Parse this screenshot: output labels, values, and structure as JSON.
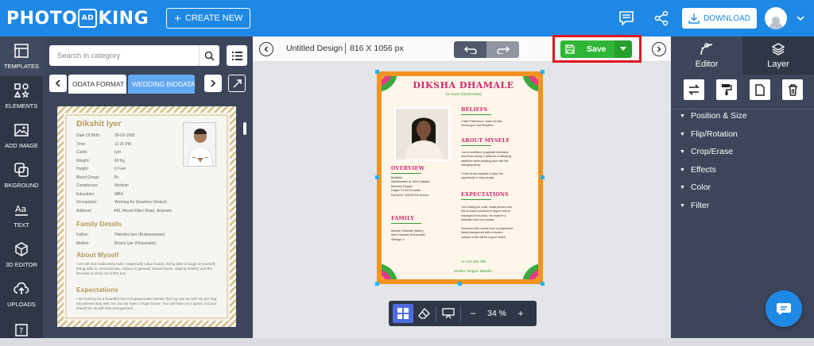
{
  "brand": {
    "logo_left": "PHOTO",
    "logo_mid": "AD",
    "logo_right": "KING"
  },
  "header": {
    "create_label": "CREATE NEW",
    "download_label": "DOWNLOAD"
  },
  "leftnav": {
    "items": [
      {
        "label": "TEMPLATES"
      },
      {
        "label": "ELEMENTS"
      },
      {
        "label": "ADD IMAGE"
      },
      {
        "label": "BKGROUND"
      },
      {
        "label": "TEXT"
      },
      {
        "label": "3D EDITOR"
      },
      {
        "label": "UPLOADS"
      }
    ]
  },
  "panel": {
    "search_placeholder": "Search in category",
    "tabs": [
      "ODATA FORMAT",
      "WEDDING BIODATA"
    ],
    "thumbnail": {
      "name": "Dikshit Iyer",
      "fields": [
        [
          "Date Of Birth:",
          "28-03-1995"
        ],
        [
          "Time:",
          "11:25 PM"
        ],
        [
          "Caste:",
          "Iyer"
        ],
        [
          "Weight:",
          "60 Kg"
        ],
        [
          "Height:",
          "6 Feet"
        ],
        [
          "Blood Group:",
          "B+"
        ],
        [
          "Complexion:",
          "Medium"
        ],
        [
          "Education:",
          "MBA"
        ],
        [
          "Occupation:",
          "Working As Smartmo Infotech"
        ],
        [
          "Address:",
          "445, Mount Eden Road, Anytown"
        ]
      ],
      "family_heading": "Family Details",
      "family": [
        [
          "Father:",
          "Hitendra Iyer (Businessman)"
        ],
        [
          "Mother:",
          "Bhanu Iyer (Housewife)"
        ]
      ],
      "about_heading": "About Myself",
      "about_text": "I am tall and moderately built. I especially value humor, being able to laugh at yourself, being able to communicate, culture in general, social issues, staying healthy and the freedom to think out of the box.",
      "expect_heading": "Expectations",
      "expect_text": "I am looking for a beautiful and compassionate woman that can put up with my pet dog. My parents stay with me, but we have a huge house. You will have your space, but you should be ok with this arrangement."
    }
  },
  "canvas": {
    "title": "Untitled Design",
    "size": "816 X 1056 px",
    "save_label": "Save",
    "zoom": "34 %"
  },
  "biodata": {
    "name": "DIKSHA DHAMALE",
    "age": "24 Years (01/01/1994)",
    "beliefs_heading": "BELIEFS",
    "beliefs": [
      "Caste Preference: Caste No Bar",
      "Horoscope: Not Required"
    ],
    "about_heading": "ABOUT MYSELF",
    "about": [
      "I am a confident, pragmatic individual",
      "who loves family & believes in following",
      "traditions while keeping pace with the",
      "changing times.",
      "",
      "I work at any hospital & enjoy the",
      "opportunity to help people."
    ],
    "overview_heading": "OVERVIEW",
    "overview": [
      "Buddhist",
      "Administrator At John Hospital",
      "Bachelor Degree",
      "Height: 5 Feet 6 Inches",
      "Earns Rs. 300000 Per Annum"
    ],
    "expect_heading": "EXPECTATIONS",
    "expect": [
      "I am looking for a tall, smart person who",
      "has at least a bachelor's degree and is",
      "employed in mumbai. He must be a",
      "teetotaler and non smoker.",
      "",
      "Someone who comes from a progressive",
      "family background with a modern",
      "outlook on life will be a good match."
    ],
    "family_heading": "FAMILY",
    "family": [
      "Anirudh Dhamale (Writer)",
      "Srini Dhamale (Housewife)",
      "Siblings: 4"
    ],
    "contact": "+0 123 456 789",
    "tongue": "Mother Tongue: Marathi"
  },
  "rightpanel": {
    "tab_editor": "Editor",
    "tab_layer": "Layer",
    "sections": [
      "Position & Size",
      "Flip/Rotation",
      "Crop/Erase",
      "Effects",
      "Color",
      "Filter"
    ]
  },
  "colors": {
    "brand_blue": "#1e88e5",
    "save_green": "#2fb636",
    "highlight_red": "#e0161e",
    "biodata_pink": "#d4256b",
    "biodata_green": "#3a9b3a"
  }
}
